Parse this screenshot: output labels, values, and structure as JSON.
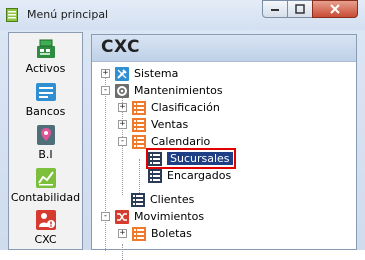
{
  "window": {
    "title": "Menú principal"
  },
  "sidebar": {
    "items": [
      {
        "label": "Activos",
        "icon": "cash-register-icon",
        "color": "#2e8b3f"
      },
      {
        "label": "Bancos",
        "icon": "bank-icon",
        "color": "#2f8fd1"
      },
      {
        "label": "B.I",
        "icon": "location-pin-icon",
        "color": "#d94a8c"
      },
      {
        "label": "Contabilidad",
        "icon": "chart-line-icon",
        "color": "#6cab2f"
      },
      {
        "label": "CXC",
        "icon": "person-alert-icon",
        "color": "#d63b2f"
      }
    ],
    "selected": "CXC"
  },
  "main": {
    "header": "CXC",
    "tree": [
      {
        "label": "Sistema",
        "icon": "tools-icon",
        "expander": "+"
      },
      {
        "label": "Mantenimientos",
        "icon": "gear-icon",
        "expander": "-"
      },
      {
        "label": "Clasificación",
        "icon": "list-orange-icon",
        "expander": "+"
      },
      {
        "label": "Ventas",
        "icon": "list-orange-icon",
        "expander": "+"
      },
      {
        "label": "Calendario",
        "icon": "list-orange-icon",
        "expander": "-"
      },
      {
        "label": "Sucursales",
        "icon": "list-dark-icon",
        "expander": ""
      },
      {
        "label": "Encargados",
        "icon": "list-dark-icon",
        "expander": ""
      },
      {
        "label": "Clientes",
        "icon": "list-dark-icon",
        "expander": ""
      },
      {
        "label": "Movimientos",
        "icon": "shuffle-icon",
        "expander": "-"
      },
      {
        "label": "Boletas",
        "icon": "list-orange-icon",
        "expander": "+"
      }
    ],
    "selected_node": "Sucursales"
  }
}
